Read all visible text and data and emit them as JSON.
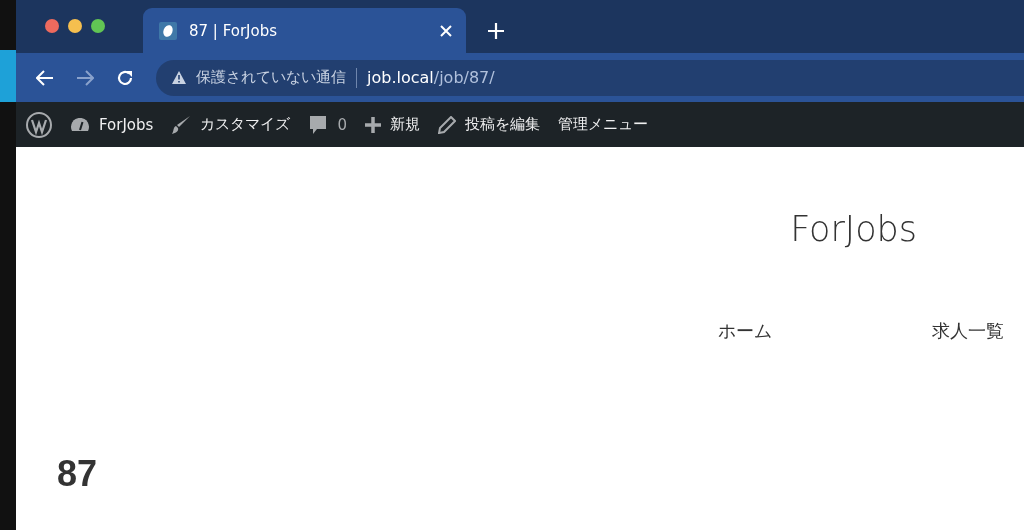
{
  "browser": {
    "tabs": [
      {
        "title": "87 | ForJobs",
        "selected": true
      }
    ],
    "security_label": "保護されていない通信",
    "url_host": "job.local",
    "url_path": "/job/87/"
  },
  "admin_bar": {
    "items": [
      {
        "kind": "logo"
      },
      {
        "kind": "site",
        "label": "ForJobs"
      },
      {
        "kind": "customize",
        "label": "カスタマイズ"
      },
      {
        "kind": "comments",
        "label": "0"
      },
      {
        "kind": "new",
        "label": "新規"
      },
      {
        "kind": "edit",
        "label": "投稿を編集"
      },
      {
        "kind": "menu",
        "label": "管理メニュー"
      }
    ]
  },
  "site": {
    "title": "ForJobs",
    "nav": [
      "ホーム",
      "求人一覧"
    ]
  },
  "post": {
    "title": "87"
  }
}
